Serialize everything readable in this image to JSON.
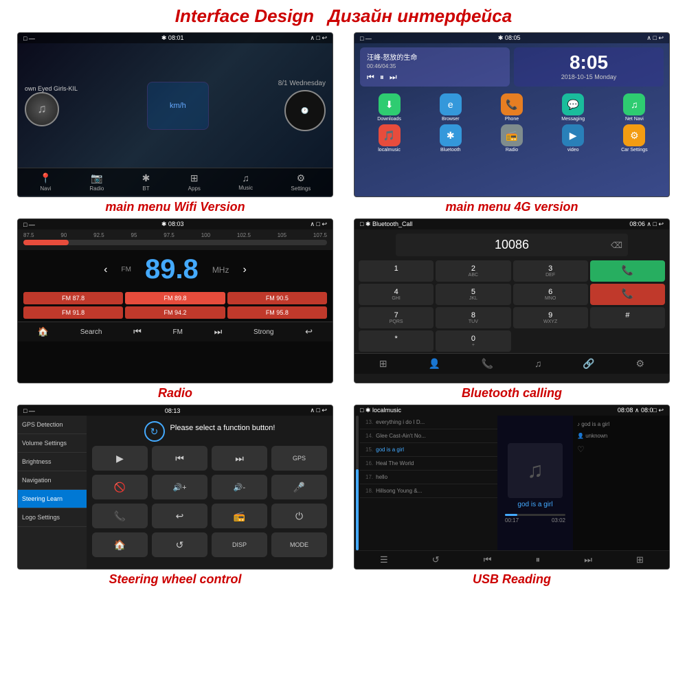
{
  "page": {
    "title_en": "Interface Design",
    "title_ru": "Дизайн интерфейса"
  },
  "screens": [
    {
      "id": "s1",
      "caption": "main menu Wifi Version",
      "statusbar": {
        "left": "□  —",
        "center": "✱  08:01",
        "right": "∧  □  ↩"
      },
      "song": "own Eyed Girls-KIL",
      "date": "8/1 Wednesday",
      "navbar": [
        "Navi",
        "Radio",
        "BT",
        "Apps",
        "Music",
        "Settings"
      ]
    },
    {
      "id": "s2",
      "caption": "main menu 4G version",
      "statusbar": {
        "left": "□  —",
        "center": "✱  08:05",
        "right": "∧  □  ↩"
      },
      "time": "8:05",
      "date": "2018-10-15  Monday",
      "apps": [
        "Downloads",
        "Browser",
        "Phone",
        "Messaging",
        "Net Navi",
        "localmusic",
        "Bluetooth",
        "Radio",
        "video",
        "Car Settings"
      ]
    },
    {
      "id": "s3",
      "caption": "Radio",
      "statusbar": {
        "left": "□  —",
        "center": "✱  08:03",
        "right": "∧  □  ↩"
      },
      "freq": "89.8",
      "freq_scale": [
        "87.5",
        "90",
        "92.5",
        "95",
        "97.5",
        "100",
        "102.5",
        "105",
        "107.5"
      ],
      "presets": [
        "FM 87.8",
        "FM 89.8",
        "FM 90.5",
        "FM 91.8",
        "FM 94.2",
        "FM 95.8"
      ]
    },
    {
      "id": "s4",
      "caption": "Bluetooth calling",
      "statusbar": {
        "left": "□ ✱ Bluetooth_Call",
        "right": "08:06  ∧  □  ↩"
      },
      "number": "10086",
      "keys": [
        "1",
        "2 ABC",
        "3 DEF",
        "*",
        "4 GHI",
        "5 JKL",
        "6 MNO",
        "0 +",
        "7 PQRS",
        "8 TUV",
        "9 WXYZ",
        "#"
      ]
    },
    {
      "id": "s5",
      "caption": "Steering wheel control",
      "statusbar": {
        "left": "□  —",
        "center": "08:13",
        "right": "∧  □  ↩"
      },
      "sidebar": [
        "GPS Detection",
        "Volume Settings",
        "Brightness",
        "Navigation",
        "Steering Learn",
        "Logo Settings"
      ],
      "active_item": "Steering Learn",
      "instruction": "Please select a function button!",
      "buttons": [
        "▶",
        "⏮",
        "⏭",
        "GPS",
        "🚫",
        "🔊+",
        "🔊-",
        "🎤",
        "📞",
        "↩",
        "📻",
        "⏻",
        "🏠",
        "↺",
        "DISP",
        "MODE"
      ]
    },
    {
      "id": "s6",
      "caption": "USB Reading",
      "statusbar": {
        "left": "□ ✱ localmusic",
        "right": "08:08  ∧08:0□  ↩"
      },
      "tracks": [
        {
          "num": "13.",
          "title": "everything i do I D..."
        },
        {
          "num": "14.",
          "title": "Glee Cast-Ain't No..."
        },
        {
          "num": "15.",
          "title": "god is a girl",
          "active": true
        },
        {
          "num": "16.",
          "title": "Heal The World"
        },
        {
          "num": "17.",
          "title": "hello"
        },
        {
          "num": "18.",
          "title": "Hillsong Young &..."
        }
      ],
      "right_tracks": [
        "god is a girl",
        "unknown",
        "♡"
      ],
      "song_name": "god is a girl",
      "time_current": "00:17",
      "time_total": "03:02"
    }
  ]
}
